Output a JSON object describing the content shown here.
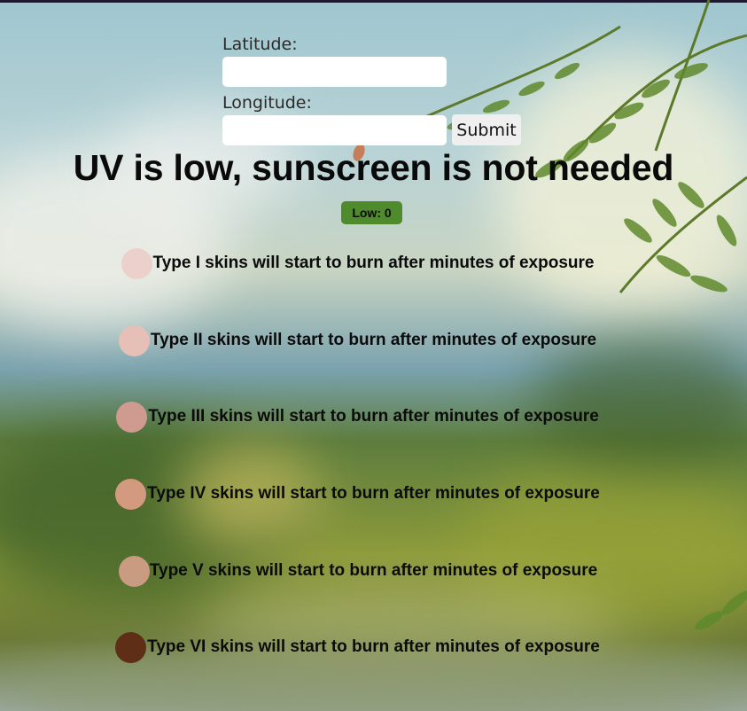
{
  "form": {
    "latitude_label": "Latitude:",
    "latitude_value": "",
    "longitude_label": "Longitude:",
    "longitude_value": "",
    "submit_label": "Submit"
  },
  "result": {
    "headline": "UV is low, sunscreen is not needed",
    "badge": "Low: 0",
    "badge_color": "#4f8a2c"
  },
  "skin_types": [
    {
      "text": "Type I skins will start to burn after minutes of exposure",
      "color": "#ecd0cc"
    },
    {
      "text": "Type II skins will start to burn after minutes of exposure",
      "color": "#e6c0b6"
    },
    {
      "text": "Type III skins will start to burn after minutes of exposure",
      "color": "#cf9a90"
    },
    {
      "text": "Type IV skins will start to burn after minutes of exposure",
      "color": "#d49a80"
    },
    {
      "text": "Type V skins will start to burn after minutes of exposure",
      "color": "#c99b80"
    },
    {
      "text": "Type VI skins will start to burn after minutes of exposure",
      "color": "#5e2f16"
    }
  ]
}
